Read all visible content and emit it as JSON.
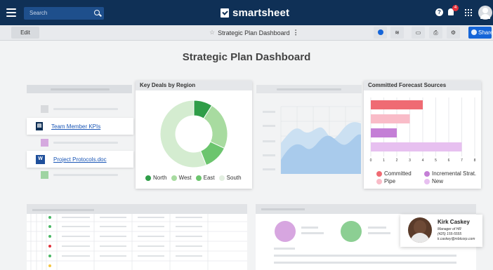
{
  "topbar": {
    "search_placeholder": "Search",
    "brand": "smartsheet",
    "notification_count": "4"
  },
  "toolbar": {
    "edit_label": "Edit",
    "sheet_title": "Strategic Plan Dashboard",
    "share_label": "Share"
  },
  "dashboard": {
    "title": "Strategic Plan Dashboard"
  },
  "links": [
    {
      "label": "Team Member KPIs",
      "icon": "document-icon"
    },
    {
      "label": "Project Protocols.doc",
      "icon": "word-icon"
    }
  ],
  "key_deals": {
    "title": "Key Deals by Region",
    "legend": [
      "North",
      "West",
      "East",
      "South"
    ]
  },
  "forecast": {
    "title": "Committed Forecast Sources",
    "legend": [
      "Committed",
      "Incremental Strat.",
      "Pipe",
      "New"
    ]
  },
  "contact": {
    "name": "Kirk Caskey",
    "role": "Manager of HR",
    "phone": "(425) 155-5555",
    "email": "k.caskey@mbtcorp.com"
  },
  "chart_data": [
    {
      "type": "pie",
      "title": "Key Deals by Region",
      "categories": [
        "North",
        "West",
        "East",
        "South"
      ],
      "values": [
        9,
        23,
        12,
        56
      ],
      "colors": [
        "#2f9d48",
        "#a8dba0",
        "#6cc56e",
        "#d4ecd0"
      ]
    },
    {
      "type": "bar",
      "title": "Committed Forecast Sources",
      "orientation": "horizontal",
      "categories": [
        "Committed",
        "Pipe",
        "Incremental Strat.",
        "New"
      ],
      "values": [
        4,
        3,
        2,
        7
      ],
      "xlim": [
        0,
        8
      ],
      "xticks": [
        "0",
        "1",
        "2",
        "3",
        "4",
        "5",
        "6",
        "7",
        "8"
      ],
      "colors": [
        "#ef6b73",
        "#f9bcc8",
        "#c47fd6",
        "#e7c0f0"
      ]
    }
  ]
}
